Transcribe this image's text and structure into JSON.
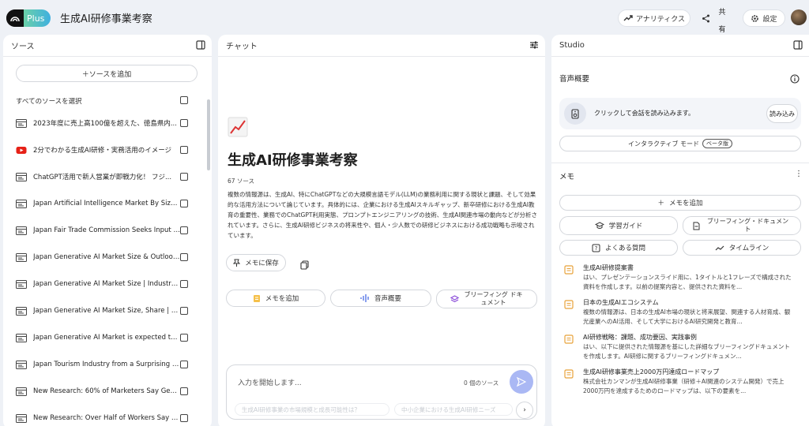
{
  "app": {
    "logo_text": "Plus",
    "title": "生成AI研修事業考察"
  },
  "topbar": {
    "analytics_label": "アナリティクス",
    "share_label": "共有",
    "settings_label": "設定"
  },
  "sources": {
    "title": "ソース",
    "add_label": "ソースを追加",
    "select_all_label": "すべてのソースを選択",
    "items": [
      {
        "type": "doc",
        "label": "2023年度に売上高100億を超えた、徳島県内..."
      },
      {
        "type": "youtube",
        "label": "2分でわかる生成AI研修・実務活用のイメージ"
      },
      {
        "type": "doc",
        "label": "ChatGPT活用で新人営業が即戦力化！ フジ..."
      },
      {
        "type": "doc",
        "label": "Japan Artificial Intelligence Market By Size, ..."
      },
      {
        "type": "doc",
        "label": "Japan Fair Trade Commission Seeks Input o..."
      },
      {
        "type": "doc",
        "label": "Japan Generative AI Market Size & Outlook, ..."
      },
      {
        "type": "doc",
        "label": "Japan Generative AI Market Size | Industry R..."
      },
      {
        "type": "doc",
        "label": "Japan Generative AI Market Size, Share | CA..."
      },
      {
        "type": "doc",
        "label": "Japan Generative AI Market is expected to r..."
      },
      {
        "type": "doc",
        "label": "Japan Tourism Industry from a Surprising Pe..."
      },
      {
        "type": "doc",
        "label": "New Research: 60% of Marketers Say Gener..."
      },
      {
        "type": "doc",
        "label": "New Research: Over Half of Workers Say Ge..."
      }
    ]
  },
  "chat": {
    "title": "チャット",
    "notebook_title": "生成AI研修事業考察",
    "source_count": "67 ソース",
    "summary": "複数の情報源は、生成AI、特にChatGPTなどの大規模言語モデル(LLM)の業務利用に関する現状と課題、そして効果的な活用方法について論じています。具体的には、企業における生成AIスキルギャップ、新卒研修における生成AI教育の重要性、業務でのChatGPT利用実態、プロンプトエンジニアリングの技術、生成AI関連市場の動向などが分析されています。さらに、生成AI研修ビジネスの将来性や、個人・少人数での研修ビジネスにおける成功戦略も示唆されています。",
    "save_note_label": "メモに保存",
    "add_note_label": "メモを追加",
    "audio_overview_label": "音声概要",
    "briefing_label": "ブリーフィング ドキュメント",
    "input_placeholder": "入力を開始します...",
    "input_source_count": "0 個のソース",
    "suggestions": [
      "生成AI研修事業の市場規模と成長可能性は？",
      "中小企業における生成AI研修ニーズ"
    ]
  },
  "studio": {
    "title": "Studio",
    "audio_title": "音声概要",
    "audio_card_text": "クリックして会話を読み込みます。",
    "load_label": "読み込み",
    "interactive_label": "インタラクティブ モード",
    "beta_label": "ベータ版",
    "notes_title": "メモ",
    "add_note_label": "メモを追加",
    "study_guide_label": "学習ガイド",
    "briefing_doc_label": "ブリーフィング・ドキュメント",
    "faq_label": "よくある質問",
    "timeline_label": "タイムライン",
    "notes": [
      {
        "title": "生成AI研修提案書",
        "body": "はい、プレゼンテーションスライド用に、1タイトルと1フレーズで構成された資料を作成します。以前の提案内容と、提供された資料を..."
      },
      {
        "title": "日本の生成AIエコシステム",
        "body": "複数の情報源は、日本の生成AI市場の現状と将来展望、関連する人材育成、観光産業へのAI活用、そして大学におけるAI研究開発と教育..."
      },
      {
        "title": "AI研修戦略：課題、成功要因、実践事例",
        "body": "はい、以下に提供された情報源を基にした詳細なブリーフィングドキュメントを作成します。AI研修に関するブリーフィングドキュメン..."
      },
      {
        "title": "生成AI研修事業売上2000万円達成ロードマップ",
        "body": "株式会社カンマンが生成AI研修事業（研修＋AI関連のシステム開発）で売上2000万円を達成するためのロードマップは、以下の要素を..."
      }
    ]
  },
  "colors": {
    "accent": "#aab8f4",
    "youtube": "#e62117",
    "note_icon": "#e8a23a"
  }
}
